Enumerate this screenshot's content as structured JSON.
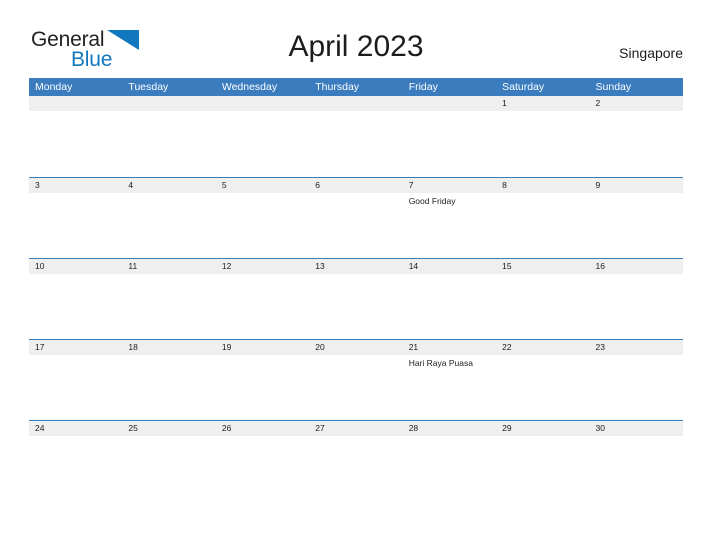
{
  "brand": {
    "name_part1": "General",
    "name_part2": "Blue",
    "flag_icon": "blue-flag-triangle",
    "accent_color": "#1278be"
  },
  "header": {
    "title": "April 2023",
    "locale": "Singapore"
  },
  "theme": {
    "header_blue": "#3b7cbf",
    "date_band_gray": "#efefef",
    "page_background": "#ffffff",
    "text_color": "#1c1c1c"
  },
  "calendar": {
    "weekdays": [
      "Monday",
      "Tuesday",
      "Wednesday",
      "Thursday",
      "Friday",
      "Saturday",
      "Sunday"
    ],
    "weeks": [
      {
        "days": [
          {
            "number": "",
            "event": ""
          },
          {
            "number": "",
            "event": ""
          },
          {
            "number": "",
            "event": ""
          },
          {
            "number": "",
            "event": ""
          },
          {
            "number": "",
            "event": ""
          },
          {
            "number": "1",
            "event": ""
          },
          {
            "number": "2",
            "event": ""
          }
        ]
      },
      {
        "days": [
          {
            "number": "3",
            "event": ""
          },
          {
            "number": "4",
            "event": ""
          },
          {
            "number": "5",
            "event": ""
          },
          {
            "number": "6",
            "event": ""
          },
          {
            "number": "7",
            "event": "Good Friday"
          },
          {
            "number": "8",
            "event": ""
          },
          {
            "number": "9",
            "event": ""
          }
        ]
      },
      {
        "days": [
          {
            "number": "10",
            "event": ""
          },
          {
            "number": "11",
            "event": ""
          },
          {
            "number": "12",
            "event": ""
          },
          {
            "number": "13",
            "event": ""
          },
          {
            "number": "14",
            "event": ""
          },
          {
            "number": "15",
            "event": ""
          },
          {
            "number": "16",
            "event": ""
          }
        ]
      },
      {
        "days": [
          {
            "number": "17",
            "event": ""
          },
          {
            "number": "18",
            "event": ""
          },
          {
            "number": "19",
            "event": ""
          },
          {
            "number": "20",
            "event": ""
          },
          {
            "number": "21",
            "event": "Hari Raya Puasa"
          },
          {
            "number": "22",
            "event": ""
          },
          {
            "number": "23",
            "event": ""
          }
        ]
      },
      {
        "days": [
          {
            "number": "24",
            "event": ""
          },
          {
            "number": "25",
            "event": ""
          },
          {
            "number": "26",
            "event": ""
          },
          {
            "number": "27",
            "event": ""
          },
          {
            "number": "28",
            "event": ""
          },
          {
            "number": "29",
            "event": ""
          },
          {
            "number": "30",
            "event": ""
          }
        ]
      }
    ]
  }
}
